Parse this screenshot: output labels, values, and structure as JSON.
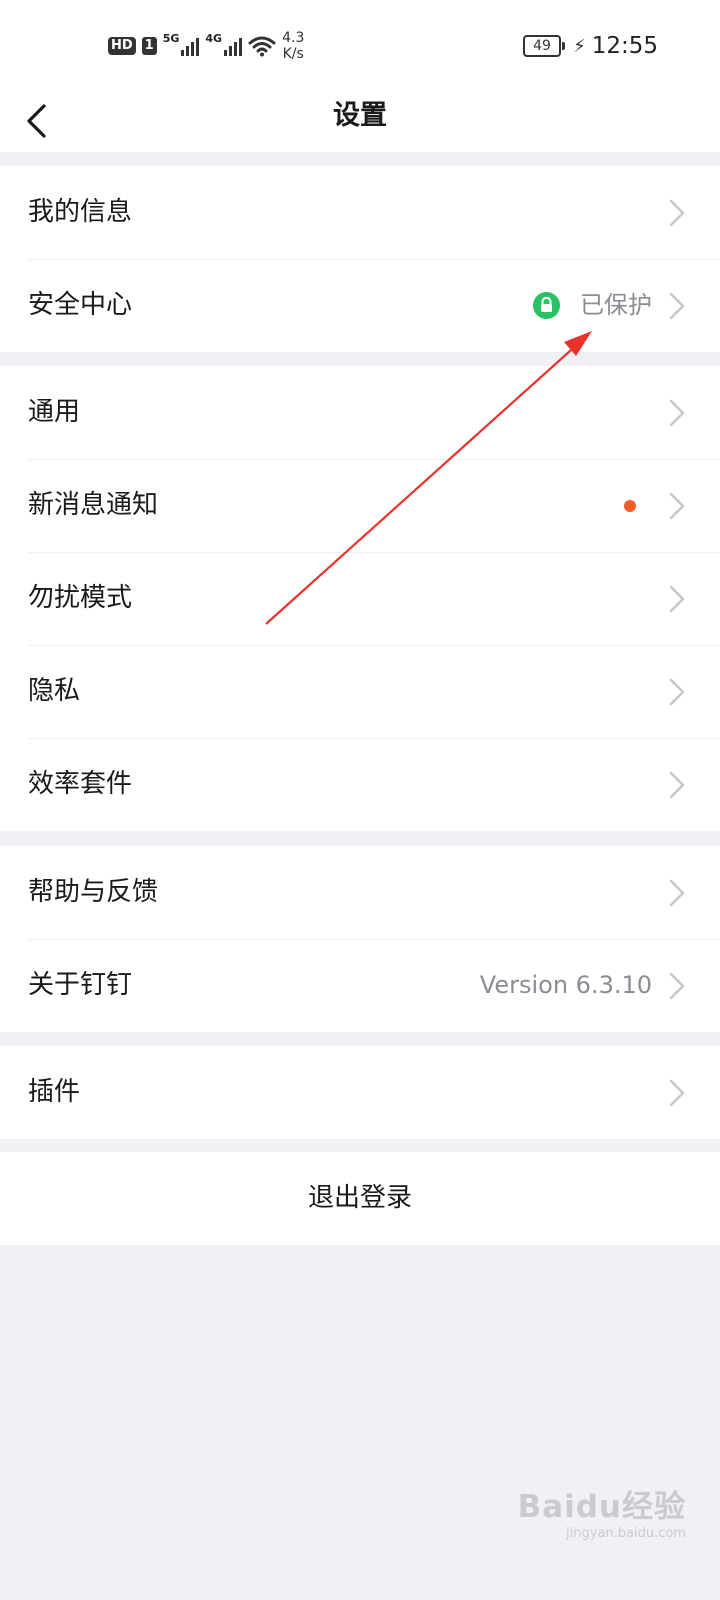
{
  "status_bar": {
    "hd": "HD",
    "sim": "1",
    "net1": "5G",
    "net2": "4G",
    "speed_value": "4.3",
    "speed_unit": "K/s",
    "battery": "49",
    "time": "12:55"
  },
  "nav": {
    "title": "设置",
    "back_icon": "back-arrow-icon"
  },
  "groups": [
    {
      "items": [
        {
          "label": "我的信息"
        },
        {
          "label": "安全中心",
          "value": "已保护",
          "icon": "lock-icon",
          "icon_color": "#2bc265"
        }
      ]
    },
    {
      "items": [
        {
          "label": "通用"
        },
        {
          "label": "新消息通知",
          "badge_color": "#f25a2a"
        },
        {
          "label": "勿扰模式"
        },
        {
          "label": "隐私"
        },
        {
          "label": "效率套件"
        }
      ]
    },
    {
      "items": [
        {
          "label": "帮助与反馈"
        },
        {
          "label": "关于钉钉",
          "value": "Version 6.3.10"
        }
      ]
    },
    {
      "items": [
        {
          "label": "插件"
        }
      ]
    }
  ],
  "logout_label": "退出登录",
  "colors": {
    "background": "#f0f1f5",
    "annotation_arrow": "#e8322a"
  },
  "watermark": {
    "logo": "Baidu经验",
    "sub": "jingyan.baidu.com"
  }
}
